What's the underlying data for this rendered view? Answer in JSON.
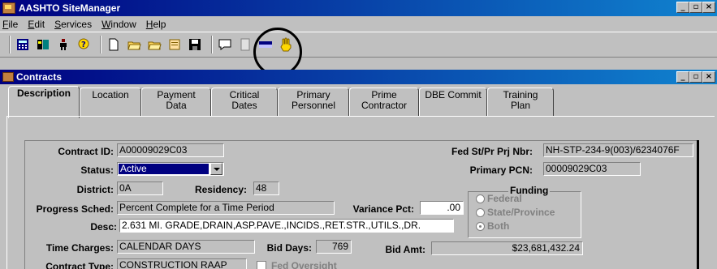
{
  "app": {
    "title": "AASHTO SiteManager",
    "window_buttons": [
      "_",
      "▫",
      "×"
    ]
  },
  "menu": [
    "File",
    "Edit",
    "Services",
    "Window",
    "Help"
  ],
  "toolbar": {
    "icons": [
      "calculator-icon",
      "toolbox-icon",
      "figure-icon",
      "help-icon",
      "new-document-icon",
      "open-folder-icon",
      "open-folder-2-icon",
      "note-icon",
      "save-icon",
      "comment-icon",
      "document-icon",
      "flag-icon",
      "hand-pointer-icon"
    ]
  },
  "child": {
    "title": "Contracts"
  },
  "tabs": [
    {
      "label": "Description",
      "active": true
    },
    {
      "label": "Location"
    },
    {
      "label": "Payment Data"
    },
    {
      "label": "Critical Dates"
    },
    {
      "label": "Primary Personnel"
    },
    {
      "label": "Prime Contractor"
    },
    {
      "label": "DBE Commit"
    },
    {
      "label": "Training Plan"
    }
  ],
  "form": {
    "contract_id_label": "Contract ID:",
    "contract_id": "A00009029C03",
    "fed_label": "Fed St/Pr Prj Nbr:",
    "fed_value": "NH-STP-234-9(003)/6234076F",
    "status_label": "Status:",
    "status_value": "Active",
    "primary_pcn_label": "Primary PCN:",
    "primary_pcn": "00009029C03",
    "district_label": "District:",
    "district": "0A",
    "residency_label": "Residency:",
    "residency": "48",
    "progress_label": "Progress Sched:",
    "progress": "Percent Complete for a Time Period",
    "variance_label": "Variance Pct:",
    "variance": ".00",
    "desc_label": "Desc:",
    "desc": "2.631 MI. GRADE,DRAIN,ASP.PAVE.,INCIDS.,RET.STR.,UTILS.,DR.",
    "time_label": "Time Charges:",
    "time": "CALENDAR DAYS",
    "bid_days_label": "Bid Days:",
    "bid_days": "769",
    "bid_amt_label": "Bid Amt:",
    "bid_amt": "$23,681,432.24",
    "contract_type_label": "Contract Type:",
    "contract_type": "CONSTRUCTION RAAP",
    "fed_oversight_label": "Fed Oversight"
  },
  "funding": {
    "title": "Funding",
    "options": [
      "Federal",
      "State/Province",
      "Both"
    ],
    "selected": "Both"
  }
}
